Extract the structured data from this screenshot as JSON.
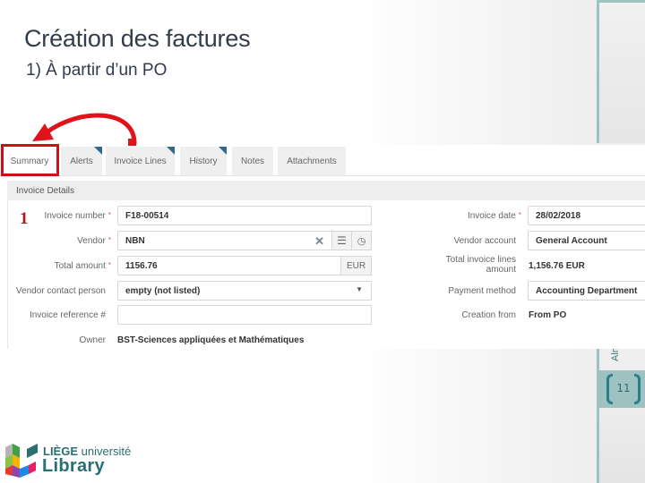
{
  "slide": {
    "title": "Création des factures",
    "subtitle": "1) À partir d’un PO",
    "step_marker": "1",
    "page_number": "11",
    "side_text": "Alm"
  },
  "tabs": [
    {
      "label": "Summary",
      "active": true,
      "flag": false
    },
    {
      "label": "Alerts",
      "active": false,
      "flag": true
    },
    {
      "label": "Invoice Lines",
      "active": false,
      "flag": true
    },
    {
      "label": "History",
      "active": false,
      "flag": true
    },
    {
      "label": "Notes",
      "active": false,
      "flag": false
    },
    {
      "label": "Attachments",
      "active": false,
      "flag": false
    }
  ],
  "panel": {
    "title": "Invoice Details",
    "left": {
      "invoice_number": {
        "label": "Invoice number",
        "value": "F18-00514",
        "required": "*"
      },
      "vendor": {
        "label": "Vendor",
        "value": "NBN",
        "required": "*"
      },
      "total_amount": {
        "label": "Total amount",
        "value": "1156.76",
        "currency": "EUR",
        "required": "*"
      },
      "vendor_contact": {
        "label": "Vendor contact person",
        "value": "empty (not listed)"
      },
      "invoice_reference": {
        "label": "Invoice reference #",
        "value": ""
      },
      "owner": {
        "label": "Owner",
        "value": "BST-Sciences appliquées et Mathématiques"
      }
    },
    "right": {
      "invoice_date": {
        "label": "Invoice date",
        "value": "28/02/2018",
        "required": "*"
      },
      "vendor_account": {
        "label": "Vendor account",
        "value": "General Account"
      },
      "total_lines": {
        "label_line1": "Total invoice lines",
        "label_line2": "amount",
        "value": "1,156.76 EUR"
      },
      "payment_method": {
        "label": "Payment method",
        "value": "Accounting Department"
      },
      "creation_from": {
        "label": "Creation from",
        "value": "From PO"
      }
    }
  },
  "logo": {
    "line1_bold": "LIÈGE",
    "line1_rest": " université",
    "line2": "Library"
  },
  "colors": {
    "highlight_red": "#d40c14",
    "teal_accent": "#2a6e72",
    "tab_flag": "#2f6a8f"
  }
}
